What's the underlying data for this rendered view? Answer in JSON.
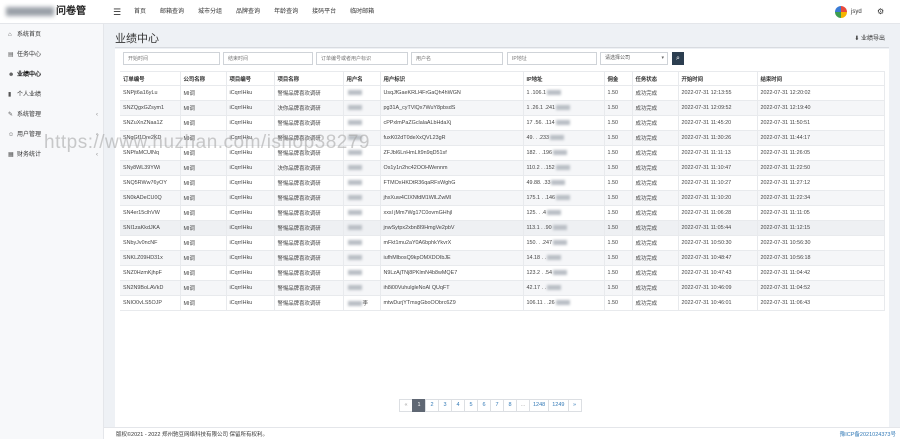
{
  "app": {
    "title": "问卷管"
  },
  "topnav": {
    "items": [
      "首页",
      "邮箱查询",
      "城市分组",
      "品牌查询",
      "年龄查询",
      "接码平台",
      "临时邮箱"
    ]
  },
  "user": {
    "name": "jsyd"
  },
  "sidebar": {
    "items": [
      {
        "label": "系统首页",
        "icon": "home-icon"
      },
      {
        "label": "任务中心",
        "icon": "task-icon"
      },
      {
        "label": "业绩中心",
        "icon": "user-icon",
        "active": true
      },
      {
        "label": "个人业绩",
        "icon": "chart-icon"
      },
      {
        "label": "系统管理",
        "icon": "wrench-icon",
        "arrow": "‹"
      },
      {
        "label": "用户管理",
        "icon": "users-icon",
        "arrow": "‹"
      },
      {
        "label": "财务统计",
        "icon": "finance-icon",
        "arrow": "‹"
      }
    ]
  },
  "page": {
    "title": "业绩中心",
    "export_label": "业绩导出"
  },
  "filters": {
    "start_placeholder": "开始时间",
    "end_placeholder": "结束时间",
    "order_placeholder": "订单编号或者用户标识",
    "user_placeholder": "用户名",
    "ip_placeholder": "IP地址",
    "company_value": "请选择公司"
  },
  "table": {
    "columns": [
      "订单编号",
      "公司名称",
      "项目编号",
      "项目名称",
      "用户名",
      "用户标识",
      "IP地址",
      "佣金",
      "任务状态",
      "开始时间",
      "结束时间"
    ],
    "rows": [
      [
        "SNPjt6a16yLu",
        "MI调",
        "iCqrrIHku",
        "警惕品牌喜欢调研",
        "",
        "UsqJfGaeKRLl4FrGaQh4hWGN",
        "1  .106.1",
        "1.50",
        "成功完成",
        "2022-07-31 12:13:55",
        "2022-07-31 12:20:02"
      ],
      [
        "SNZQgxGZsym1",
        "MI调",
        "iCqrrIHku",
        "决你品牌喜欢调研",
        "",
        "pg31A_cyTVlQx7WuY8pbsdS",
        "1  .26.1  .241",
        "1.50",
        "成功完成",
        "2022-07-31 12:09:52",
        "2022-07-31 12:19:40"
      ],
      [
        "SNZuXnZNaa1Z",
        "MI调",
        "iCqrrIHku",
        "警惕品牌喜欢调研",
        "",
        "cPPxlmPaZGclalaALbHdaXj",
        "17  .56.  .114",
        "1.50",
        "成功完成",
        "2022-07-31 11:45:20",
        "2022-07-31 11:50:51"
      ],
      [
        "SNqGf1Dre2KD",
        "MI调",
        "iCqrrIHku",
        "警惕品牌喜欢调研",
        "",
        "fuxK02dT0deXxQVL23gR",
        "49.  .  .233",
        "1.50",
        "成功完成",
        "2022-07-31 11:30:26",
        "2022-07-31 11:44:17"
      ],
      [
        "SNPfaMCUlNq",
        "MI调",
        "iCqrrIHku",
        "警惕品牌喜欢调研",
        "",
        "ZFJbI6LnHmLIt9n9qD51sf",
        "182.  .  .196",
        "1.50",
        "成功完成",
        "2022-07-31 11:11:13",
        "2022-07-31 11:26:05"
      ],
      [
        "SNy8WL39YWi",
        "MI调",
        "iCqrrIHku",
        "决你品牌喜欢调研",
        "",
        "Os1y1n2hc42OOHWennm",
        "110.2  .  .152",
        "1.50",
        "成功完成",
        "2022-07-31 11:10:47",
        "2022-07-31 11:22:50"
      ],
      [
        "SNQ5RWw76yOY",
        "MI调",
        "iCqrrIHku",
        "警惕品牌喜欢调研",
        "",
        "FTMOxHKDtR36qaRFsWghG",
        "49.88.  .33",
        "1.50",
        "成功完成",
        "2022-07-31 11:10:27",
        "2022-07-31 11:27:12"
      ],
      [
        "SN0kADeCU0Q",
        "MI调",
        "iCqrrIHku",
        "警惕品牌喜欢调研",
        "",
        "jhxXuw4CIXNfdM1WlLZwMl",
        "175.1  .  .146",
        "1.50",
        "成功完成",
        "2022-07-31 11:10:20",
        "2022-07-31 11:22:34"
      ],
      [
        "SN4er15clhVW",
        "MI调",
        "iCqrrIHku",
        "警惕品牌喜欢调研",
        "",
        "xxsl jMm7Wg17C0ovmGHhjl",
        "125.  .  .4",
        "1.50",
        "成功完成",
        "2022-07-31 11:06:28",
        "2022-07-31 11:11:05"
      ],
      [
        "SNI1zaKkdJKA",
        "MI调",
        "iCqrrIHku",
        "警惕品牌喜欢调研",
        "",
        "jnwSytpx2xbn8I9HmgVe2pbV",
        "113.1  .  .90",
        "1.50",
        "成功完成",
        "2022-07-31 11:05:44",
        "2022-07-31 11:12:15"
      ],
      [
        "SNbyJv0ncNF",
        "MI调",
        "iCqrrIHku",
        "警惕品牌喜欢调研",
        "",
        "mFkt1mu2aY0A6bphkYkvrX",
        "150.  .  .247",
        "1.50",
        "成功完成",
        "2022-07-31 10:50:30",
        "2022-07-31 10:56:30"
      ],
      [
        "SNKLZ09HD31x",
        "MI调",
        "iCqrrIHku",
        "警惕品牌喜欢调研",
        "",
        "iufhMlbosQ9kpOMXDOIbJE",
        "14.18  .  .",
        "1.50",
        "成功完成",
        "2022-07-31 10:48:47",
        "2022-07-31 10:56:18"
      ],
      [
        "SNZ0HzmKjhpF",
        "MI调",
        "iCqrrIHku",
        "警惕品牌喜欢调研",
        "",
        "N9LzAjTNj8PKlmN4b8wMQE7",
        "123.2  .  .54",
        "1.50",
        "成功完成",
        "2022-07-31 10:47:43",
        "2022-07-31 11:04:42"
      ],
      [
        "SN2N9BoLAVkD",
        "MI调",
        "iCqrrIHku",
        "警惕品牌喜欢调研",
        "",
        "ih8i00VuhulgleNoAl QUqFT",
        "42.17  .  .",
        "1.50",
        "成功完成",
        "2022-07-31 10:46:09",
        "2022-07-31 11:04:52"
      ],
      [
        "SNIO0vLS5OJP",
        "MI调",
        "iCqrrIHku",
        "警惕品牌喜欢调研",
        "李",
        "mtwDurjYTmsgGboOObrc6Z9",
        "106.11  .  .26",
        "1.50",
        "成功完成",
        "2022-07-31 10:46:01",
        "2022-07-31 11:06:43"
      ]
    ]
  },
  "pagination": {
    "items": [
      "«",
      "1",
      "2",
      "3",
      "4",
      "5",
      "6",
      "7",
      "8",
      "...",
      "1248",
      "1249",
      "»"
    ],
    "active": "1"
  },
  "footer": {
    "copyright": "版权©2021 - 2022 郑州驰豆网络科技有限公司 保留所有权利。",
    "icp": "豫ICP备2021024373号"
  },
  "watermark": "https://www.huzhan.com/ishop38279"
}
